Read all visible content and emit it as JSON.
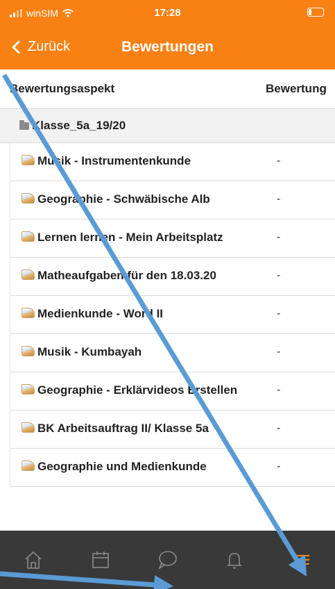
{
  "statusbar": {
    "carrier": "winSIM",
    "time": "17:28"
  },
  "nav": {
    "back_label": "Zurück",
    "title": "Bewertungen"
  },
  "table": {
    "col_aspect": "Bewertungsaspekt",
    "col_grade": "Bewertung",
    "category": "Klasse_5a_19/20",
    "rows": [
      {
        "name": "Musik - Instrumentenkunde",
        "grade": "-"
      },
      {
        "name": "Geographie - Schwäbische Alb",
        "grade": "-"
      },
      {
        "name": "Lernen lernen - Mein Arbeitsplatz",
        "grade": "-"
      },
      {
        "name": "Matheaufgaben für den 18.03.20",
        "grade": "-"
      },
      {
        "name": "Medienkunde - Word II",
        "grade": "-"
      },
      {
        "name": "Musik - Kumbayah",
        "grade": "-"
      },
      {
        "name": "Geographie - Erklärvideos Erstellen",
        "grade": "-"
      },
      {
        "name": "BK Arbeitsauftrag II/ Klasse 5a",
        "grade": "-"
      },
      {
        "name": "Geographie und Medienkunde",
        "grade": "-"
      }
    ]
  },
  "tabbar": {
    "icons": [
      "home-icon",
      "calendar-icon",
      "messages-icon",
      "notifications-icon",
      "menu-icon"
    ],
    "active": "menu-icon"
  },
  "colors": {
    "accent": "#f98012",
    "tabbar_bg": "#393939",
    "arrow": "#5b9bd5"
  }
}
